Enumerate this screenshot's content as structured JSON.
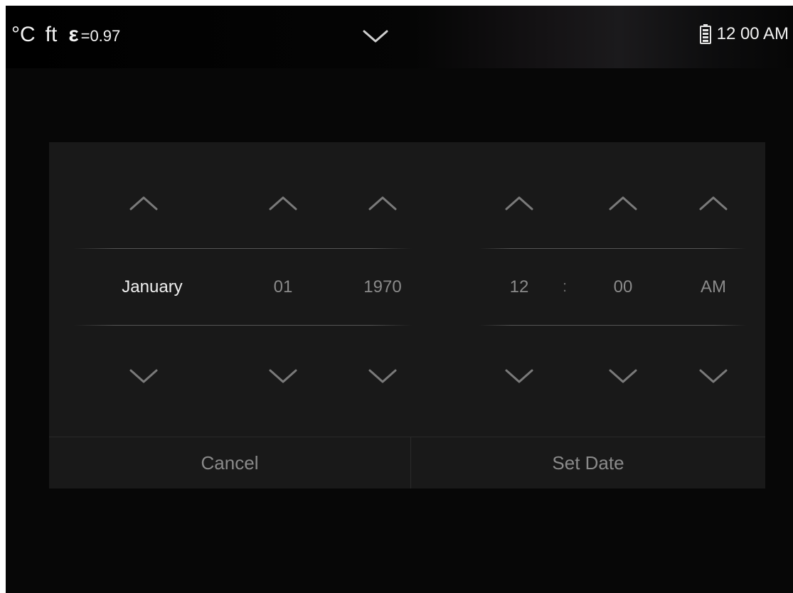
{
  "status_bar": {
    "temp_unit": "°C",
    "distance_unit": "ft",
    "emissivity_symbol": "ε",
    "emissivity_value": "=0.97",
    "expand_icon": "chevron-down-icon",
    "battery_icon": "battery-icon",
    "clock": "12 00 AM"
  },
  "date_picker": {
    "month": "January",
    "day": "01",
    "year": "1970",
    "hour": "12",
    "time_separator": ":",
    "minute": "00",
    "period": "AM"
  },
  "actions": {
    "cancel_label": "Cancel",
    "set_label": "Set Date"
  },
  "colors": {
    "background": "#070707",
    "dialog": "#191919",
    "active_text": "#f0f0f0",
    "inactive_text": "#8a8a8a",
    "arrow": "#7a7a7a"
  }
}
